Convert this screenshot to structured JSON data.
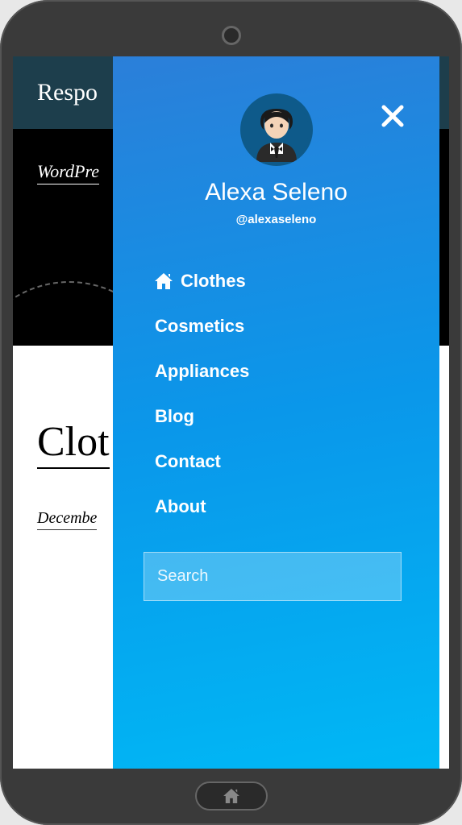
{
  "header": {
    "title": "Respo"
  },
  "banner": {
    "title": "WordPre"
  },
  "content": {
    "title": "Clot",
    "date": "Decembe"
  },
  "drawer": {
    "user_name": "Alexa Seleno",
    "user_handle": "@alexaseleno",
    "menu": [
      {
        "label": "Clothes",
        "icon": "home-icon"
      },
      {
        "label": "Cosmetics",
        "icon": ""
      },
      {
        "label": "Appliances",
        "icon": ""
      },
      {
        "label": "Blog",
        "icon": ""
      },
      {
        "label": "Contact",
        "icon": ""
      },
      {
        "label": "About",
        "icon": ""
      }
    ],
    "search": {
      "placeholder": "Search"
    }
  }
}
